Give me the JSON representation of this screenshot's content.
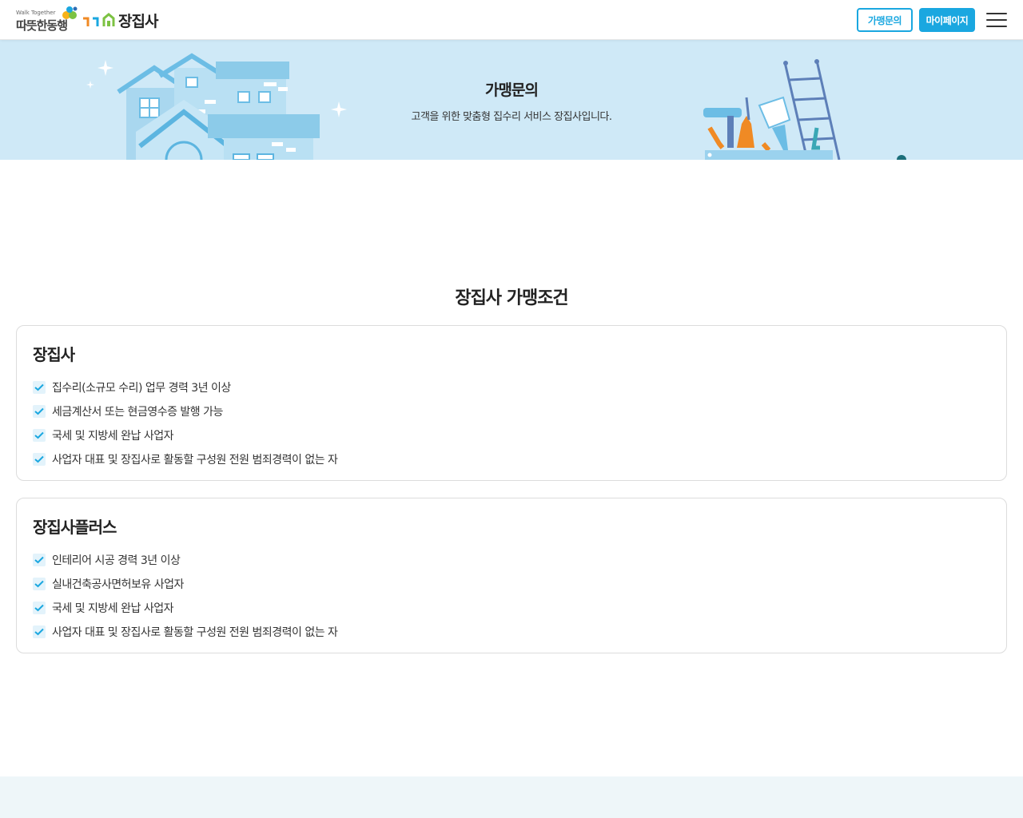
{
  "header": {
    "logo_small": "Walk Together",
    "logo_main": "따뜻한동행",
    "brand": "장집사",
    "franchise_button": "가맹문의",
    "mypage_button": "마이페이지"
  },
  "banner": {
    "title": "가맹문의",
    "subtitle": "고객을 위한 맞춤형 집수리 서비스 장집사입니다."
  },
  "section": {
    "title": "장집사 가맹조건"
  },
  "cards": [
    {
      "title": "장집사",
      "items": [
        "집수리(소규모 수리) 업무 경력 3년 이상",
        "세금계산서 또는 현금영수증 발행 가능",
        "국세 및 지방세 완납 사업자",
        "사업자 대표 및 장집사로 활동할 구성원 전원 범죄경력이 없는 자"
      ]
    },
    {
      "title": "장집사플러스",
      "items": [
        "인테리어 시공 경력 3년 이상",
        "실내건축공사면허보유 사업자",
        "국세 및 지방세 완납 사업자",
        "사업자 대표 및 장집사로 활동할 구성원 전원 범죄경력이 없는 자"
      ]
    }
  ],
  "colors": {
    "accent": "#1aa7e0",
    "banner_bg": "#cfe9f7",
    "check": "#1aa7e0",
    "footer_bg": "#eef6f9"
  },
  "icons": {
    "check": "check-icon",
    "menu": "hamburger-menu-icon"
  }
}
